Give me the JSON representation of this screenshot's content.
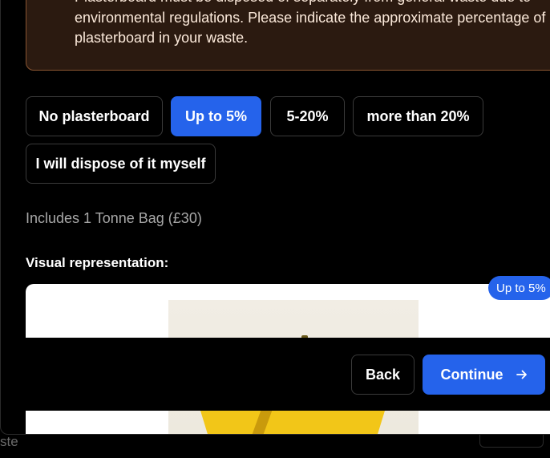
{
  "notice": {
    "text": "Plasterboard must be disposed of separately from general waste due to environmental regulations. Please indicate the approximate percentage of plasterboard in your waste."
  },
  "options": [
    {
      "label": "No plasterboard",
      "selected": false
    },
    {
      "label": "Up to 5%",
      "selected": true
    },
    {
      "label": "5-20%",
      "selected": false
    },
    {
      "label": "more than 20%",
      "selected": false
    },
    {
      "label": "I will dispose of it myself",
      "selected": false
    }
  ],
  "includes_text": "Includes 1 Tonne Bag (£30)",
  "visual": {
    "label": "Visual representation:",
    "badge": "Up to 5%"
  },
  "footer": {
    "back_label": "Back",
    "continue_label": "Continue"
  },
  "background": {
    "partial_text": "ste"
  },
  "colors": {
    "accent": "#2563eb",
    "notice_bg": "#2b1a10",
    "notice_border": "#8a5532",
    "bag": "#f2c618"
  }
}
